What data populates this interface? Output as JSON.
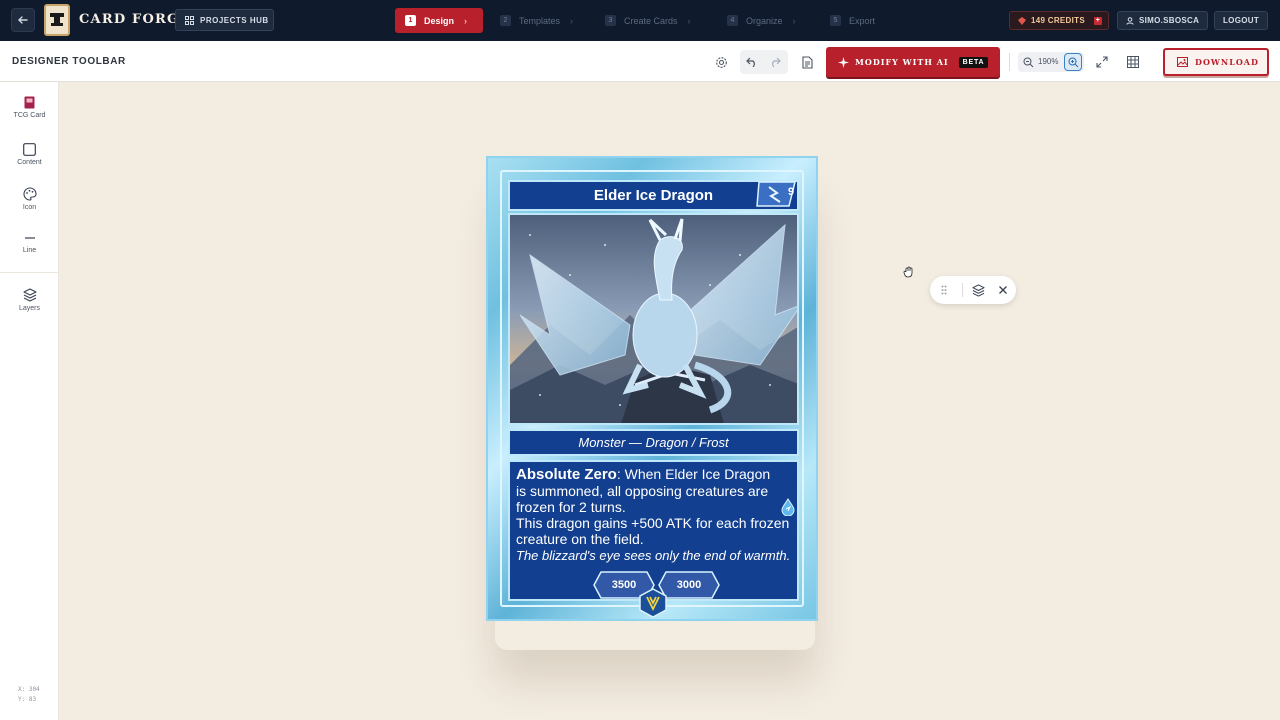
{
  "app": {
    "name": "CARD FORGE",
    "projects_hub": "PROJECTS HUB"
  },
  "steps": [
    {
      "num": "1",
      "label": "Design",
      "active": true
    },
    {
      "num": "2",
      "label": "Templates"
    },
    {
      "num": "3",
      "label": "Create Cards"
    },
    {
      "num": "4",
      "label": "Organize"
    },
    {
      "num": "5",
      "label": "Export"
    }
  ],
  "account": {
    "credits": "149 CREDITS",
    "username": "SIMO.SBOSCA",
    "logout": "LOGOUT"
  },
  "toolbar": {
    "title": "DESIGNER TOOLBAR",
    "ai_button": "MODIFY WITH AI",
    "beta": "BETA",
    "zoom": "190%",
    "download": "DOWNLOAD"
  },
  "sidebar": {
    "items": [
      {
        "label": "TCG Card",
        "icon": "card-icon"
      },
      {
        "label": "Content",
        "icon": "square-icon"
      },
      {
        "label": "Icon",
        "icon": "palette-icon"
      },
      {
        "label": "Line",
        "icon": "line-icon"
      },
      {
        "label": "Layers",
        "icon": "layers-icon"
      }
    ],
    "coords_x": "X: 304",
    "coords_y": "Y: 83"
  },
  "card": {
    "name": "Elder Ice Dragon",
    "level": "9",
    "type_line": "Monster — Dragon / Frost",
    "ability_name": "Absolute Zero",
    "ability_text_1": ": When Elder Ice Dragon is summoned, all opposing creatures are frozen for 2 turns.",
    "ability_text_2": "This dragon gains +500 ATK for each frozen creature on the field.",
    "flavor": "The blizzard's eye sees only the end of warmth.",
    "attack": "3500",
    "defense": "3000"
  },
  "colors": {
    "nav_bg": "#0f1a2c",
    "accent_red": "#b8202b",
    "canvas_bg": "#f3ece1",
    "card_blue": "#123f8f",
    "frame_ice": "#8fd3ee"
  }
}
